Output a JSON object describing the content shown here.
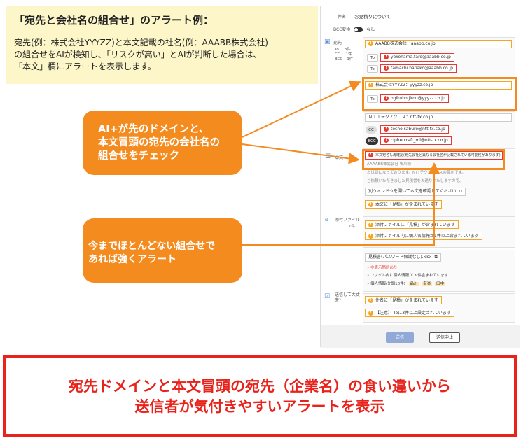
{
  "info": {
    "title": "「宛先と会社名の組合せ」のアラート例：",
    "line1": "宛先(例：株式会社YYYZZ)と本文記載の社名(例：AAABB株式会社)",
    "line2": "の組合せをAIが検知し、「リスクが高い」とAIが判断した場合は、",
    "line3": "「本文」欄にアラートを表示します。"
  },
  "callout1": {
    "line1": "AI+が先のドメインと、",
    "line2": "本文冒頭の宛先の会社名の",
    "line3": "組合せをチェック"
  },
  "callout2": {
    "line1": "今までほとんどない組合せで",
    "line2": "あれば強くアラート"
  },
  "mail": {
    "subject_label": "件名",
    "subject_value": "お見積りについて",
    "bcc_label": "BCC変換",
    "bcc_value": "なし",
    "to_label": "宛先",
    "to_sub": "To",
    "to_count": "3件",
    "cc_sub": "CC",
    "cc_count": "1件",
    "bcc_sub": "BCC",
    "bcc_count": "1件",
    "group1": "AAABB株式会社：aaabb.co.jp",
    "group1_addr1": "yokohama.taro@aaabb.co.jp",
    "group1_addr2": "tamachi.hanako@aaabb.co.jp",
    "group2": "株式会社YYYZZ：yyyzz.co.jp",
    "group2_addr1": "ogikubo.jirou@yyyzz.co.jp",
    "group3": "ＮＴＴテクノクロス：ntt-tx.co.jp",
    "group3_addr1": "techo.saburo@ntt-tx.co.jp",
    "group3_addr2": "ciphercraft_ml@ntt-tx.co.jp",
    "tag_to": "To",
    "tag_cc": "CC",
    "tag_bcc": "BCC",
    "body_label": "本文",
    "body_alert": "本文宛名も再確認(宛先会社と異なる会社名が記載されている可能性があります)",
    "body_line1": "AAAABB株式会社 鴨川様",
    "body_line2": "お世話になっております。NTTテクノクロスの品川です。",
    "body_line3": "ご依頼いただきました見積書をお送りいたしますので、",
    "body_check": "別ウィンドウを開いて本文を確認してください",
    "body_warn": "本文に「見積」が含まれています",
    "attach_label": "添付ファイル",
    "attach_count": "1件",
    "attach_warn1": "添付ファイルに「見積」が含まれています",
    "attach_warn2": "添付ファイル内に個人名情報が1件以上含まれています",
    "attach_file": "見積書(パスワード保護なし).xlsx",
    "attach_sub1": "非表示箇所あり",
    "attach_sub2": "ファイル内に個人情報が 3 件含まれています",
    "attach_sub3": "個人情報(先頭10件)",
    "attach_names": [
      "品川",
      "有楽",
      "田中"
    ],
    "confirm_label": "送信して大丈夫?",
    "confirm_warn1": "件名に「見積」が含まれています",
    "confirm_warn2": "【注意】 Toに3件以上設定されています",
    "send_label": "送信",
    "stop_label": "送信中止"
  },
  "bottom": {
    "line1": "宛先ドメインと本文冒頭の宛先（企業名）の食い違いから",
    "line2": "送信者が気付きやすいアラートを表示"
  },
  "colors": {
    "orange": "#f48b1f",
    "red": "#e8231c",
    "yellow_bg": "#fdf6c9"
  }
}
